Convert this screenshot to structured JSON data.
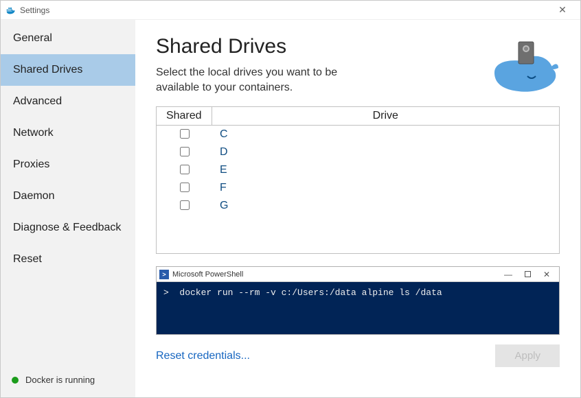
{
  "window": {
    "title": "Settings"
  },
  "sidebar": {
    "items": [
      {
        "label": "General"
      },
      {
        "label": "Shared Drives"
      },
      {
        "label": "Advanced"
      },
      {
        "label": "Network"
      },
      {
        "label": "Proxies"
      },
      {
        "label": "Daemon"
      },
      {
        "label": "Diagnose & Feedback"
      },
      {
        "label": "Reset"
      }
    ],
    "active_index": 1
  },
  "status": {
    "text": "Docker is running",
    "color": "#1b9c1b"
  },
  "page": {
    "title": "Shared Drives",
    "subtitle": "Select the local drives you want to be available to your containers."
  },
  "drives_table": {
    "headers": {
      "shared": "Shared",
      "drive": "Drive"
    },
    "rows": [
      {
        "shared": false,
        "letter": "C"
      },
      {
        "shared": false,
        "letter": "D"
      },
      {
        "shared": false,
        "letter": "E"
      },
      {
        "shared": false,
        "letter": "F"
      },
      {
        "shared": false,
        "letter": "G"
      }
    ]
  },
  "powershell": {
    "title": "Microsoft PowerShell",
    "command": ">  docker run --rm -v c:/Users:/data alpine ls /data"
  },
  "footer": {
    "reset_credentials": "Reset credentials...",
    "apply": "Apply"
  }
}
